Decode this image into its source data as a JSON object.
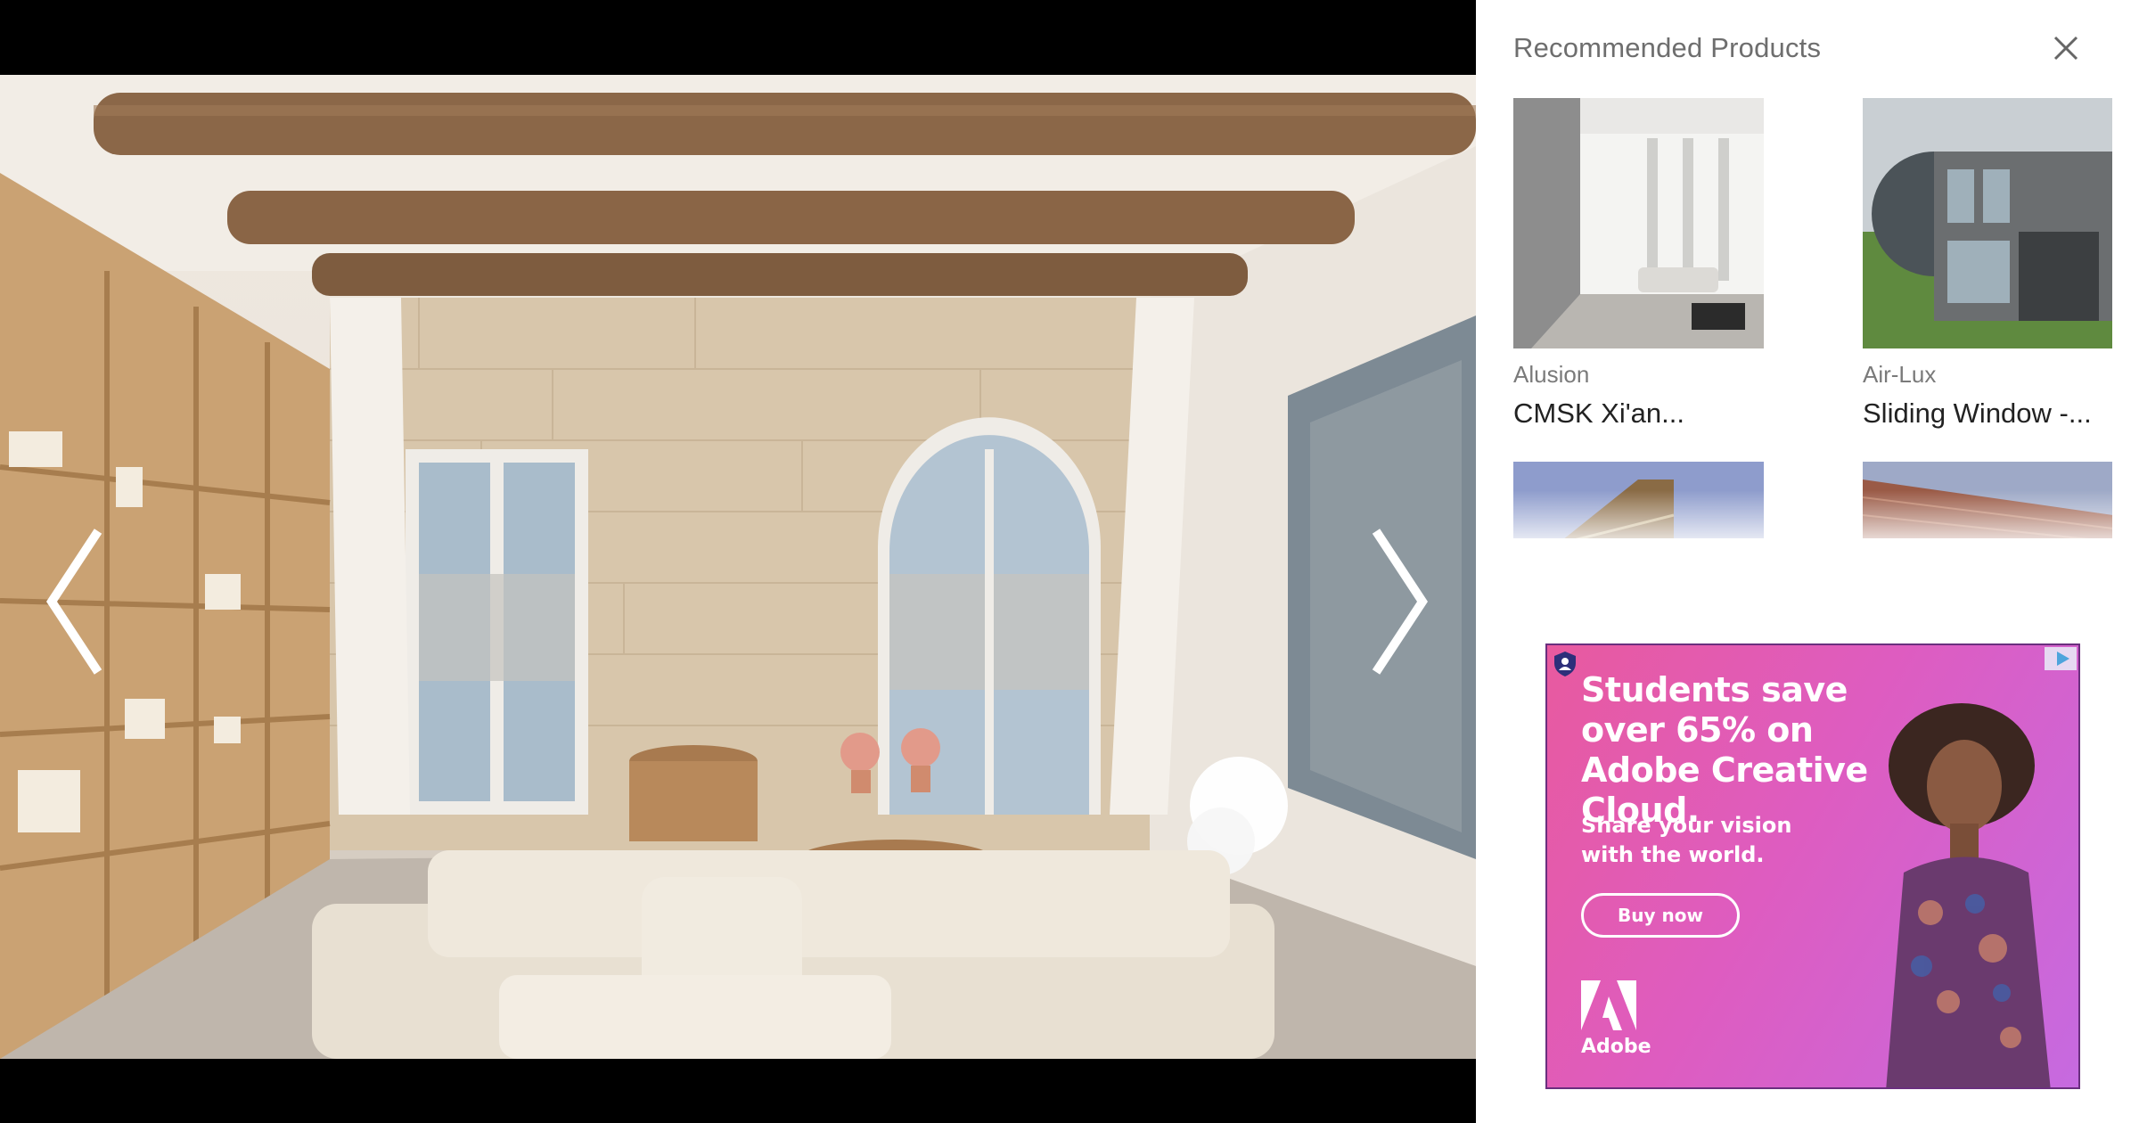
{
  "viewer": {
    "prev_icon": "chevron-left-icon",
    "next_icon": "chevron-right-icon"
  },
  "panel": {
    "title": "Recommended Products",
    "close_icon": "close-icon",
    "products": [
      {
        "brand": "Alusion",
        "name": "CMSK Xi'an..."
      },
      {
        "brand": "Air-Lux",
        "name": "Sliding Window -..."
      },
      {
        "brand": "",
        "name": ""
      },
      {
        "brand": "",
        "name": ""
      }
    ]
  },
  "ad": {
    "headline": "Students save over 65% on Adobe Creative Cloud.",
    "subline": "Share your vision with the world.",
    "cta": "Buy now",
    "brand": "Adobe",
    "colors": {
      "start": "#e85a9f",
      "end": "#c66ae0"
    }
  }
}
